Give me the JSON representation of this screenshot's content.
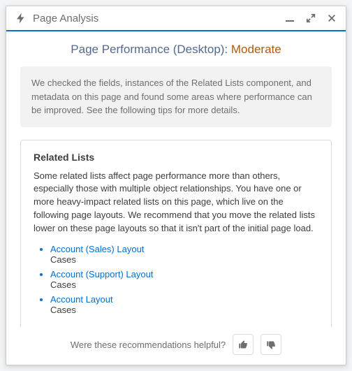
{
  "header": {
    "title": "Page Analysis"
  },
  "performance": {
    "label": "Page Performance (Desktop): ",
    "rating": "Moderate"
  },
  "summary": "We checked the fields, instances of the Related Lists component, and metadata on this page and found some areas where performance can be improved. See the following tips for more details.",
  "card": {
    "title": "Related Lists",
    "description": "Some related lists affect page performance more than others, especially those with multiple object relationships. You have one or more heavy-impact related lists on this page, which live on the following page layouts. We recommend that you move the related lists lower on these page layouts so that it isn't part of the initial page load.",
    "layouts": [
      {
        "name": "Account (Sales) Layout",
        "sub": "Cases"
      },
      {
        "name": "Account (Support) Layout",
        "sub": "Cases"
      },
      {
        "name": "Account Layout",
        "sub": "Cases"
      }
    ]
  },
  "footer": {
    "prompt": "Were these recommendations helpful?"
  }
}
